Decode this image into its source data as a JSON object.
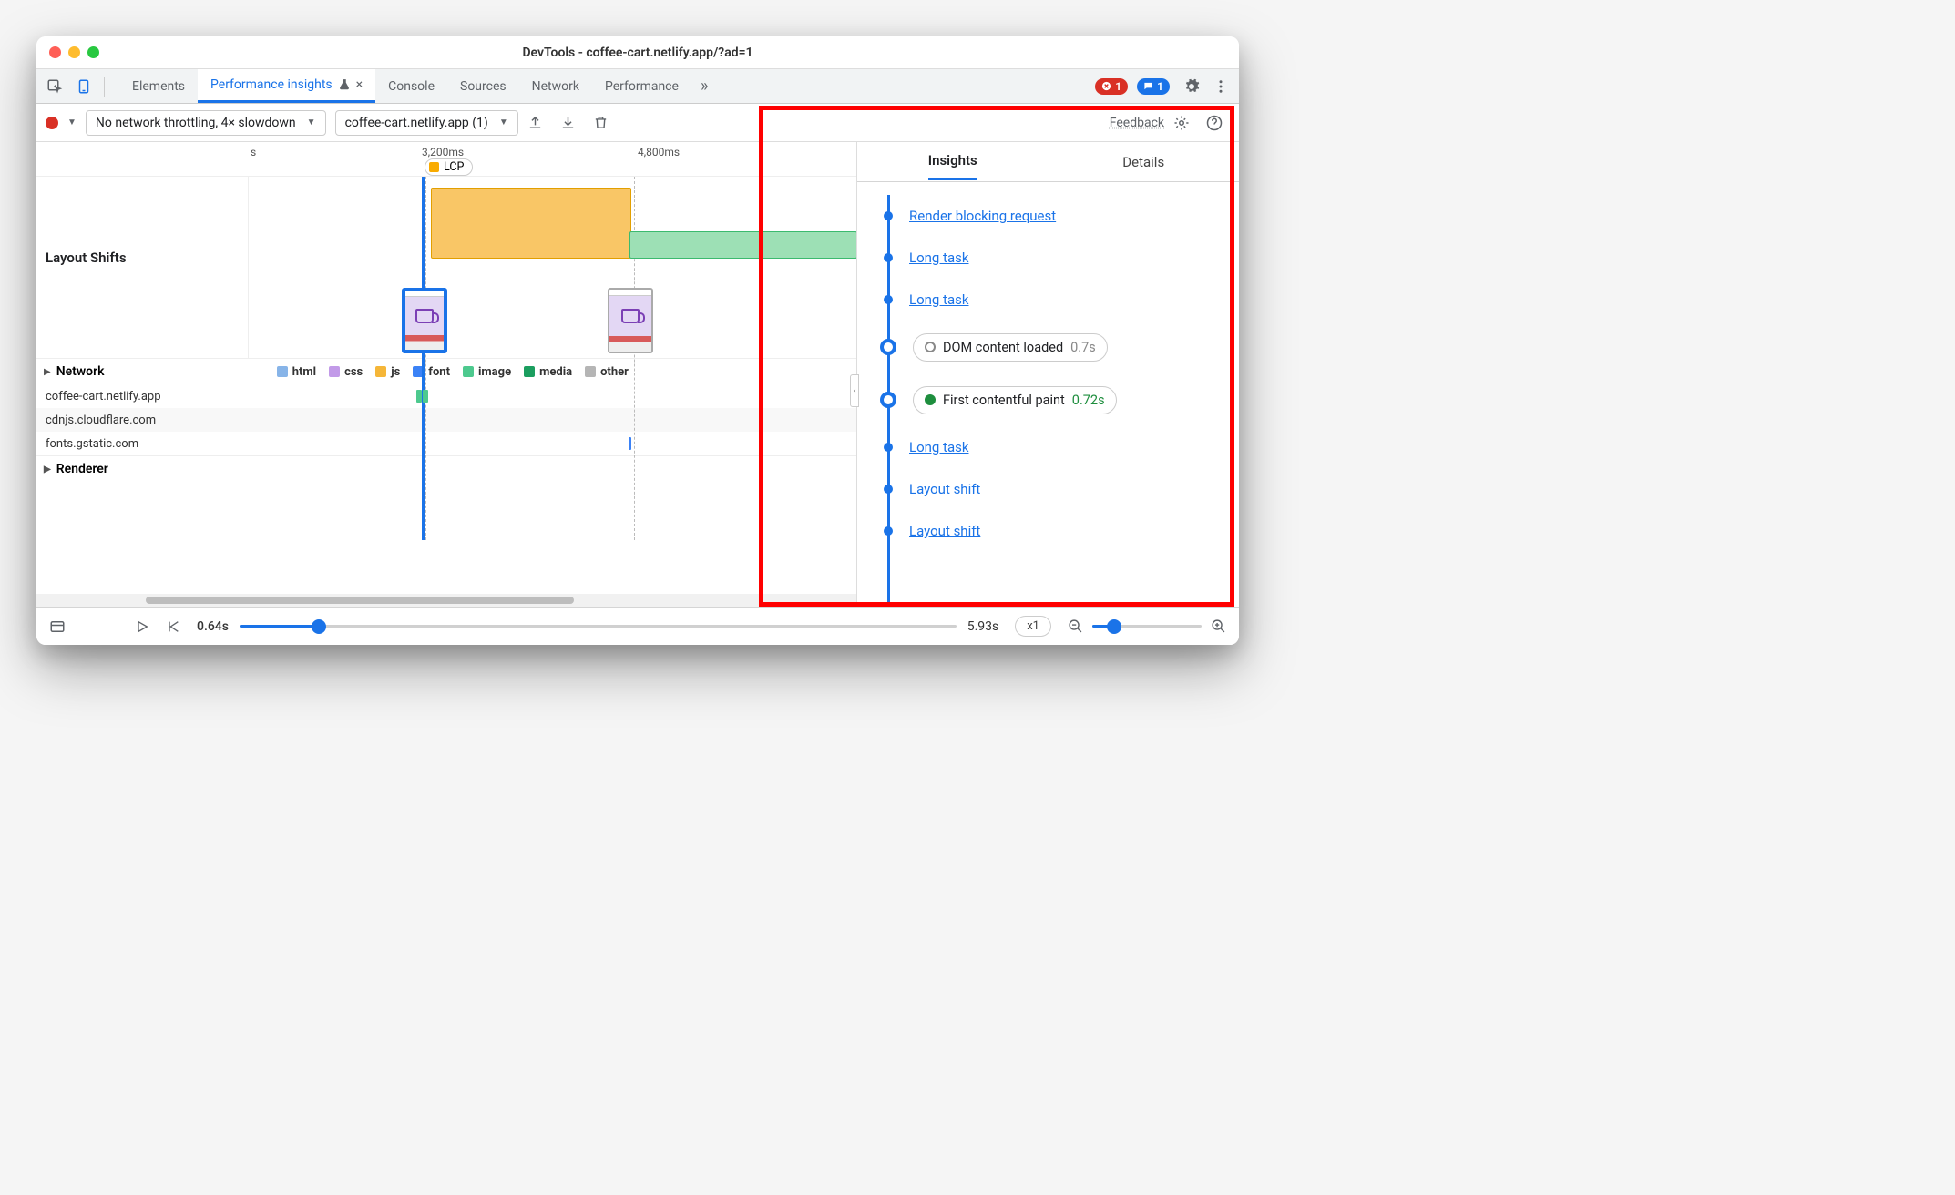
{
  "window": {
    "title": "DevTools - coffee-cart.netlify.app/?ad=1"
  },
  "tabs": {
    "items": [
      "Elements",
      "Performance insights",
      "Console",
      "Sources",
      "Network",
      "Performance"
    ],
    "active_index": 1,
    "error_count": "1",
    "info_count": "1"
  },
  "toolbar": {
    "throttling": "No network throttling, 4× slowdown",
    "page_select": "coffee-cart.netlify.app (1)",
    "feedback": "Feedback"
  },
  "timeline": {
    "ticks": {
      "t0": "s",
      "t1": "3,200ms",
      "t2": "4,800ms"
    },
    "lcp_label": "LCP",
    "sections": {
      "layout_shifts": "Layout Shifts",
      "network": "Network",
      "renderer": "Renderer"
    },
    "legend": {
      "html": "html",
      "css": "css",
      "js": "js",
      "font": "font",
      "image": "image",
      "media": "media",
      "other": "other"
    },
    "hosts": [
      "coffee-cart.netlify.app",
      "cdnjs.cloudflare.com",
      "fonts.gstatic.com"
    ]
  },
  "insights_panel": {
    "tabs": {
      "insights": "Insights",
      "details": "Details"
    },
    "items": [
      {
        "kind": "link",
        "label": "Render blocking request"
      },
      {
        "kind": "link",
        "label": "Long task"
      },
      {
        "kind": "link",
        "label": "Long task"
      },
      {
        "kind": "pill",
        "dot": "hollow",
        "label": "DOM content loaded",
        "time": "0.7s",
        "time_class": ""
      },
      {
        "kind": "pill",
        "dot": "green",
        "label": "First contentful paint",
        "time": "0.72s",
        "time_class": "green"
      },
      {
        "kind": "link",
        "label": "Long task"
      },
      {
        "kind": "link",
        "label": "Layout shift"
      },
      {
        "kind": "link",
        "label": "Layout shift"
      }
    ]
  },
  "footer": {
    "start_time": "0.64s",
    "end_time": "5.93s",
    "speed": "x1"
  }
}
